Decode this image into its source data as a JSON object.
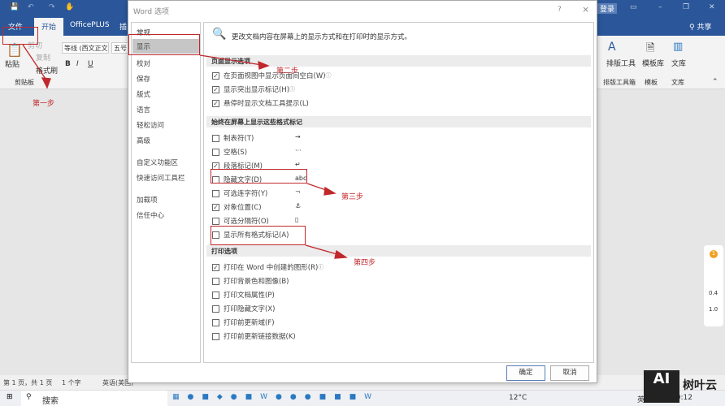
{
  "word": {
    "qat_icons": [
      "save-icon",
      "undo-icon",
      "redo-icon",
      "touch-icon"
    ],
    "login": "登录",
    "share": "共享",
    "tabs": [
      "文件",
      "开始",
      "OfficePLUS",
      "插"
    ],
    "clipboard": {
      "paste": "粘贴",
      "cut": "剪切",
      "copy": "复制",
      "format_painter": "格式刷",
      "group": "剪贴板"
    },
    "font": {
      "name": "等线 (西文正文)",
      "size": "五号",
      "bold": "B",
      "italic": "I",
      "underline": "U"
    },
    "right_groups": [
      {
        "button": "排版工具",
        "group": "排版工具箱"
      },
      {
        "button": "模板库",
        "group": "模板"
      },
      {
        "button": "文库",
        "group": "文库"
      }
    ]
  },
  "status": {
    "page": "第 1 页，共 1 页",
    "words": "1 个字",
    "lang": "英语(美国)"
  },
  "taskbar": {
    "search": "搜索",
    "weather": "12°C",
    "ime": "英",
    "time": "20:12"
  },
  "watermark": {
    "text": "树叶云"
  },
  "widget": {
    "badge": "1",
    "v1": "0.4",
    "v2": "1.0"
  },
  "dialog": {
    "title": "Word 选项",
    "help": "?",
    "close": "×",
    "nav": [
      "常规",
      "显示",
      "校对",
      "保存",
      "版式",
      "语言",
      "轻松访问",
      "高级",
      "自定义功能区",
      "快速访问工具栏",
      "加载项",
      "信任中心"
    ],
    "header": "更改文档内容在屏幕上的显示方式和在打印时的显示方式。",
    "sections": [
      {
        "title": "页面显示选项",
        "options": [
          {
            "label": "在页面视图中显示页面间空白(W)",
            "checked": true,
            "info": true
          },
          {
            "label": "显示突出显示标记(H)",
            "checked": true,
            "info": true
          },
          {
            "label": "悬停时显示文档工具提示(L)",
            "checked": true
          }
        ]
      },
      {
        "title": "始终在屏幕上显示这些格式标记",
        "options": [
          {
            "label": "制表符(T)",
            "checked": false,
            "mark": "→"
          },
          {
            "label": "空格(S)",
            "checked": false,
            "mark": "···"
          },
          {
            "label": "段落标记(M)",
            "checked": true,
            "mark": "↵"
          },
          {
            "label": "隐藏文字(D)",
            "checked": false,
            "mark": "abc"
          },
          {
            "label": "可选连字符(Y)",
            "checked": false,
            "mark": "¬"
          },
          {
            "label": "对象位置(C)",
            "checked": true,
            "mark": "⚓"
          },
          {
            "label": "可选分隔符(O)",
            "checked": false,
            "mark": "▯"
          },
          {
            "label": "显示所有格式标记(A)",
            "checked": false
          }
        ]
      },
      {
        "title": "打印选项",
        "options": [
          {
            "label": "打印在 Word 中创建的图形(R)",
            "checked": true,
            "info": true
          },
          {
            "label": "打印背景色和图像(B)",
            "checked": false
          },
          {
            "label": "打印文档属性(P)",
            "checked": false
          },
          {
            "label": "打印隐藏文字(X)",
            "checked": false
          },
          {
            "label": "打印前更新域(F)",
            "checked": false
          },
          {
            "label": "打印前更新链接数据(K)",
            "checked": false
          }
        ]
      }
    ],
    "ok": "确定",
    "cancel": "取消"
  },
  "annotations": [
    "第一步",
    "第二步",
    "第三步",
    "第四步"
  ],
  "colors": {
    "word_blue": "#2b579a",
    "annotation_red": "#c0282c"
  }
}
